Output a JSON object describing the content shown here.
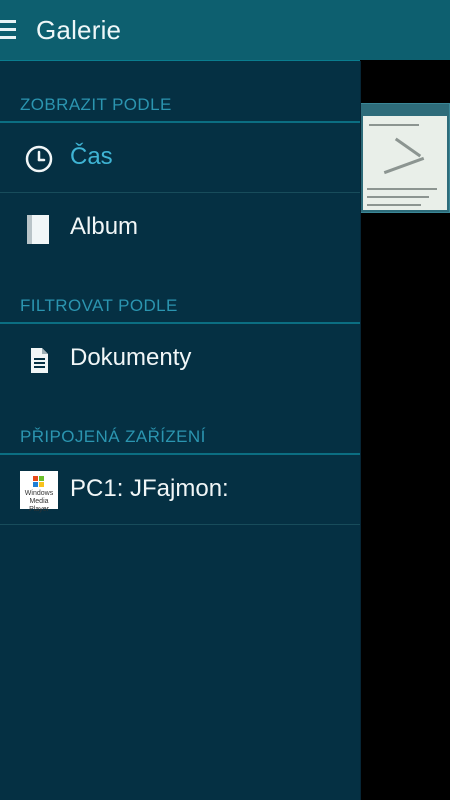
{
  "app": {
    "title": "Galerie"
  },
  "drawer": {
    "sections": [
      {
        "header": "ZOBRAZIT PODLE",
        "items": [
          {
            "label": "Čas",
            "icon": "clock-icon",
            "active": true
          },
          {
            "label": "Album",
            "icon": "album-icon",
            "active": false
          }
        ]
      },
      {
        "header": "FILTROVAT PODLE",
        "items": [
          {
            "label": "Dokumenty",
            "icon": "document-icon",
            "active": false
          }
        ]
      },
      {
        "header": "PŘIPOJENÁ ZAŘÍZENÍ",
        "items": [
          {
            "label": "PC1: JFajmon:",
            "icon": "windows-media-player-icon",
            "active": false,
            "icon_text": "Windows Media Player"
          }
        ]
      }
    ]
  },
  "colors": {
    "appbar": "#0d5f6f",
    "drawer_bg": "#053043",
    "section_header": "#2b95b0",
    "active_item": "#3fb4d4"
  }
}
